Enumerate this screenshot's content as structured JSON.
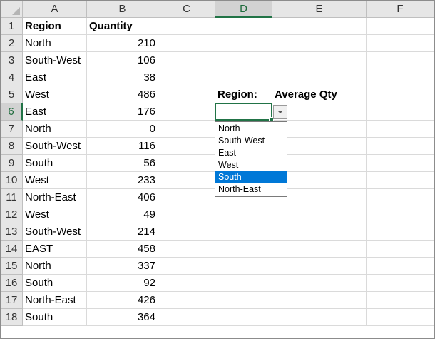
{
  "sheet": {
    "columns": [
      "A",
      "B",
      "C",
      "D",
      "E",
      "F"
    ],
    "selected_column": "D",
    "rows": [
      "1",
      "2",
      "3",
      "4",
      "5",
      "6",
      "7",
      "8",
      "9",
      "10",
      "11",
      "12",
      "13",
      "14",
      "15",
      "16",
      "17",
      "18"
    ],
    "selected_row": "6",
    "header": {
      "region": "Region",
      "quantity": "Quantity"
    },
    "data": [
      {
        "region": "North",
        "quantity": "210"
      },
      {
        "region": "South-West",
        "quantity": "106"
      },
      {
        "region": "East",
        "quantity": "38"
      },
      {
        "region": "West",
        "quantity": "486"
      },
      {
        "region": "East",
        "quantity": "176"
      },
      {
        "region": "North",
        "quantity": "0"
      },
      {
        "region": "South-West",
        "quantity": "116"
      },
      {
        "region": "South",
        "quantity": "56"
      },
      {
        "region": "West",
        "quantity": "233"
      },
      {
        "region": "North-East",
        "quantity": "406"
      },
      {
        "region": "West",
        "quantity": "49"
      },
      {
        "region": "South-West",
        "quantity": "214"
      },
      {
        "region": "EAST",
        "quantity": "458"
      },
      {
        "region": "North",
        "quantity": "337"
      },
      {
        "region": "South",
        "quantity": "92"
      },
      {
        "region": "North-East",
        "quantity": "426"
      },
      {
        "region": "South",
        "quantity": "364"
      }
    ],
    "labels": {
      "region_label": "Region:",
      "average_label": "Average Qty"
    },
    "active_cell": {
      "ref": "D6",
      "value": ""
    }
  },
  "dropdown": {
    "options": [
      "North",
      "South-West",
      "East",
      "West",
      "South",
      "North-East"
    ],
    "highlighted": "South"
  },
  "colors": {
    "accent": "#217346",
    "highlight": "#0078d7",
    "header_bg": "#e6e6e6",
    "gridline": "#dadada"
  }
}
